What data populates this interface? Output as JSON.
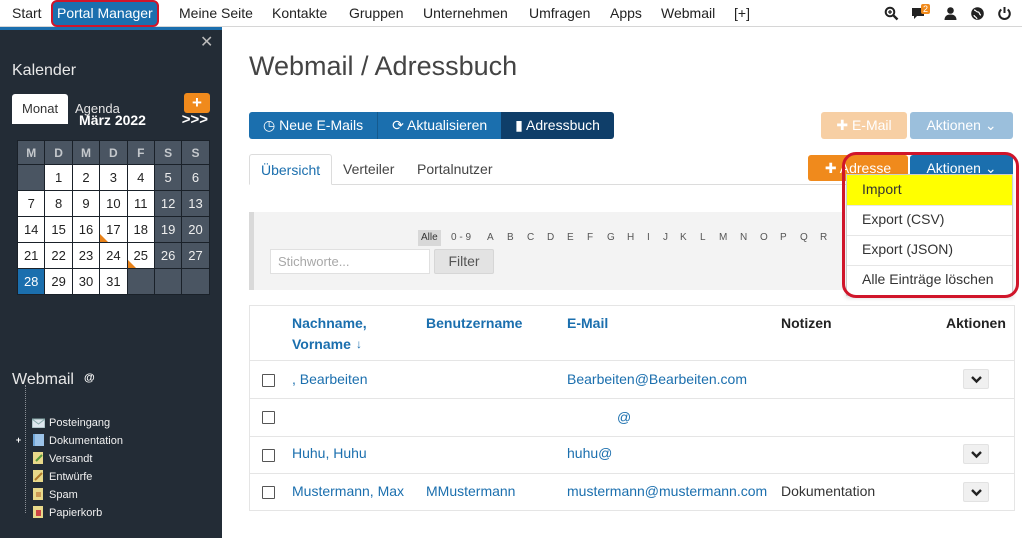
{
  "topnav": {
    "items": [
      "Start",
      "Portal Manager",
      "Meine Seite",
      "Kontakte",
      "Gruppen",
      "Unternehmen",
      "Umfragen",
      "Apps",
      "Webmail",
      "[+]"
    ],
    "active_index": 1,
    "icons": [
      "search-zoom-icon",
      "chat-icon",
      "user-icon",
      "globe-icon",
      "power-icon"
    ],
    "chat_badge": "2"
  },
  "sidebar": {
    "calendar_title": "Kalender",
    "tabs": [
      "Monat",
      "Agenda"
    ],
    "add_button": "+",
    "month_label": "März 2022",
    "prev": "<<<",
    "next": ">>>",
    "weekday_headers": [
      "M",
      "D",
      "M",
      "D",
      "F",
      "S",
      "S"
    ],
    "weeks": [
      [
        "",
        "1",
        "2",
        "3",
        "4",
        "5",
        "6"
      ],
      [
        "7",
        "8",
        "9",
        "10",
        "11",
        "12",
        "13"
      ],
      [
        "14",
        "15",
        "16",
        "17",
        "18",
        "19",
        "20"
      ],
      [
        "21",
        "22",
        "23",
        "24",
        "25",
        "26",
        "27"
      ],
      [
        "28",
        "29",
        "30",
        "31",
        "",
        "",
        ""
      ]
    ],
    "today": "28",
    "marked_days": [
      "17",
      "25"
    ],
    "webmail_title": "Webmail",
    "folder_root": "@",
    "folders": [
      "Posteingang",
      "Dokumentation",
      "Versandt",
      "Entwürfe",
      "Spam",
      "Papierkorb"
    ]
  },
  "main": {
    "title": "Webmail / Adressbuch",
    "btn_new_mails": "Neue E-Mails",
    "btn_refresh": "Aktualisieren",
    "btn_addressbook": "Adressbuch",
    "btn_email": "E-Mail",
    "btn_actions": "Aktionen",
    "subtabs": [
      "Übersicht",
      "Verteiler",
      "Portalnutzer"
    ],
    "btn_address": "Adresse",
    "btn_actions2": "Aktionen",
    "alphabet": [
      "0 - 9",
      "A",
      "B",
      "C",
      "D",
      "E",
      "F",
      "G",
      "H",
      "I",
      "J",
      "K",
      "L",
      "M",
      "N",
      "O",
      "P",
      "Q",
      "R"
    ],
    "alphabet_all": "Alle",
    "search_placeholder": "Stichworte...",
    "filter_button": "Filter",
    "table": {
      "headers": [
        "Nachname,",
        "Vorname",
        "Benutzername",
        "E-Mail",
        "Notizen",
        "Aktionen"
      ],
      "rows": [
        {
          "name": ", Bearbeiten",
          "user": "",
          "email": "Bearbeiten@Bearbeiten.com",
          "notes": ""
        },
        {
          "name": "",
          "user": "",
          "email": "@",
          "notes": ""
        },
        {
          "name": "Huhu, Huhu",
          "user": "",
          "email": "huhu@",
          "notes": ""
        },
        {
          "name": "Mustermann, Max",
          "user": "MMustermann",
          "email": "mustermann@mustermann.com",
          "notes": "Dokumentation"
        }
      ]
    },
    "dropdown": [
      "Import",
      "Export (CSV)",
      "Export (JSON)",
      "Alle Einträge löschen"
    ]
  },
  "colors": {
    "primary": "#1b6fae",
    "dark_primary": "#0f3e69",
    "orange": "#f08a1c",
    "highlight": "#ffff00",
    "annotation_red": "#d0152a",
    "sidebar": "#232c36"
  }
}
